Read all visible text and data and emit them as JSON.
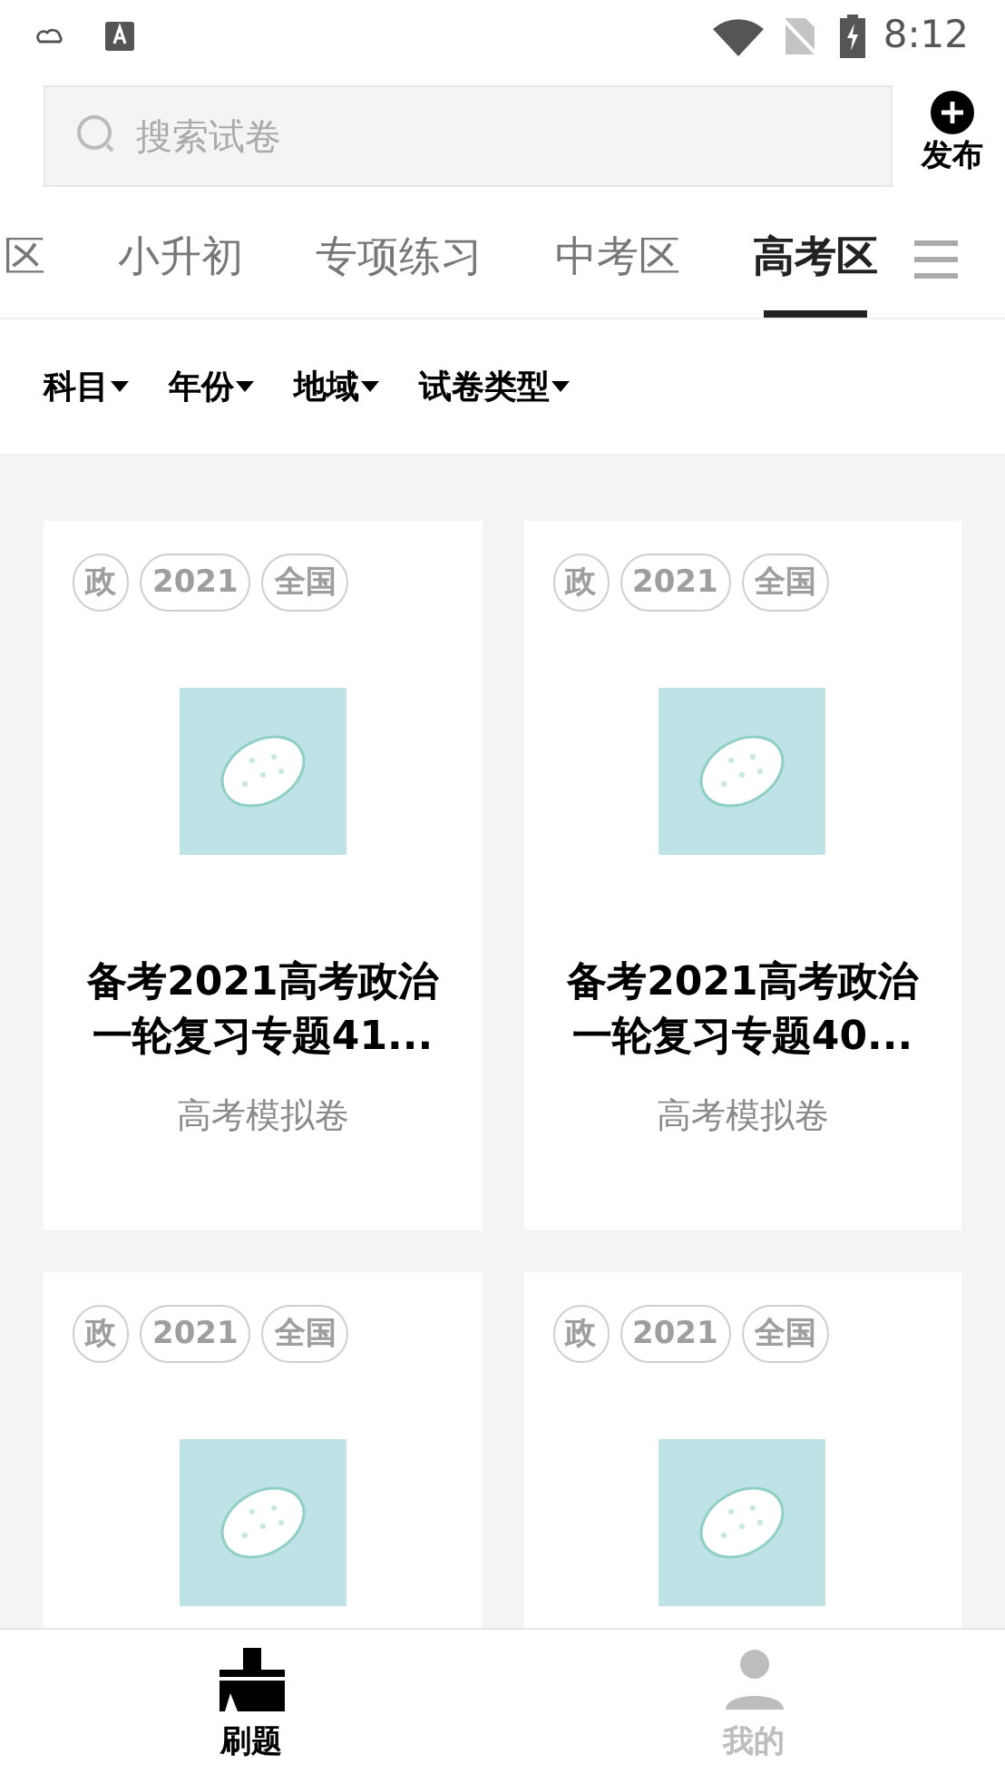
{
  "status_bar": {
    "time": "8:12"
  },
  "search": {
    "placeholder": "搜索试卷"
  },
  "publish_button": {
    "label": "发布"
  },
  "tabs": [
    {
      "label": "区",
      "selected": false
    },
    {
      "label": "小升初",
      "selected": false
    },
    {
      "label": "专项练习",
      "selected": false
    },
    {
      "label": "中考区",
      "selected": false
    },
    {
      "label": "高考区",
      "selected": true
    }
  ],
  "filters": [
    {
      "label": "科目"
    },
    {
      "label": "年份"
    },
    {
      "label": "地域"
    },
    {
      "label": "试卷类型"
    }
  ],
  "papers": [
    {
      "tags": [
        "政",
        "2021",
        "全国"
      ],
      "title": "备考2021高考政治一轮复习专题41...",
      "type": "高考模拟卷"
    },
    {
      "tags": [
        "政",
        "2021",
        "全国"
      ],
      "title": "备考2021高考政治一轮复习专题40...",
      "type": "高考模拟卷"
    },
    {
      "tags": [
        "政",
        "2021",
        "全国"
      ]
    },
    {
      "tags": [
        "政",
        "2021",
        "全国"
      ]
    }
  ],
  "bottom_nav": [
    {
      "label": "刷题",
      "kind": "practice",
      "selected": true
    },
    {
      "label": "我的",
      "kind": "profile",
      "selected": false
    }
  ]
}
